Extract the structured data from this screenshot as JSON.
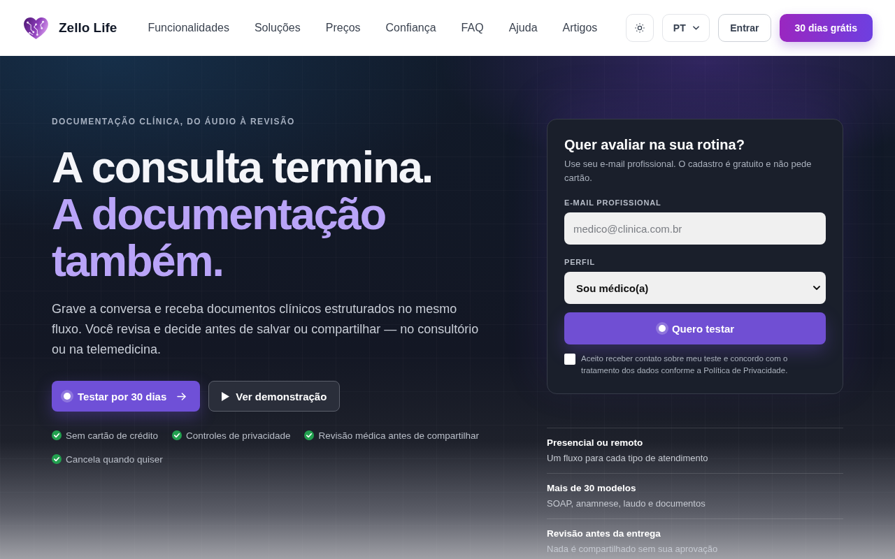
{
  "header": {
    "brand": "Zello Life",
    "nav": [
      "Funcionalidades",
      "Soluções",
      "Preços",
      "Confiança",
      "FAQ",
      "Ajuda",
      "Artigos"
    ],
    "language": "PT",
    "login": "Entrar",
    "cta": "30 dias grátis"
  },
  "hero": {
    "eyebrow": "DOCUMENTAÇÃO CLÍNICA, DO ÁUDIO À REVISÃO",
    "headline": [
      {
        "text": "A consulta termina.",
        "accent": false
      },
      {
        "text": "A documentação também.",
        "accent": true
      }
    ],
    "lead": "Grave a conversa e receba documentos clínicos estruturados no mesmo fluxo. Você revisa e decide antes de salvar ou compartilhar — no consultório ou na telemedicina.",
    "buttons": [
      {
        "label": "Testar por 30 dias",
        "kind": "primary"
      },
      {
        "label": "Ver demonstração",
        "kind": "secondary"
      }
    ],
    "benefits": [
      "Sem cartão de crédito",
      "Controles de privacidade",
      "Revisão médica antes de compartilhar",
      "Cancela quando quiser"
    ]
  },
  "signup": {
    "title": "Quer avaliar na sua rotina?",
    "subtitle": "Use seu e-mail profissional. O cadastro é gratuito e não pede cartão.",
    "fields": [
      {
        "kind": "email",
        "label": "E-MAIL PROFISSIONAL",
        "placeholder": "medico@clinica.com.br"
      },
      {
        "kind": "select",
        "label": "PERFIL",
        "value": "Sou médico(a)"
      }
    ],
    "submit": "Quero testar",
    "consent": {
      "text": "Aceito receber contato sobre meu teste e concordo com o tratamento dos dados conforme a Política de Privacidade.",
      "checked": false
    }
  },
  "features": [
    {
      "title": "Presencial ou remoto",
      "subtitle": "Um fluxo para cada tipo de atendimento"
    },
    {
      "title": "Mais de 30 modelos",
      "subtitle": "SOAP, anamnese, laudo e documentos"
    },
    {
      "title": "Revisão antes da entrega",
      "subtitle": "Nada é compartilhado sem sua aprovação"
    }
  ]
}
